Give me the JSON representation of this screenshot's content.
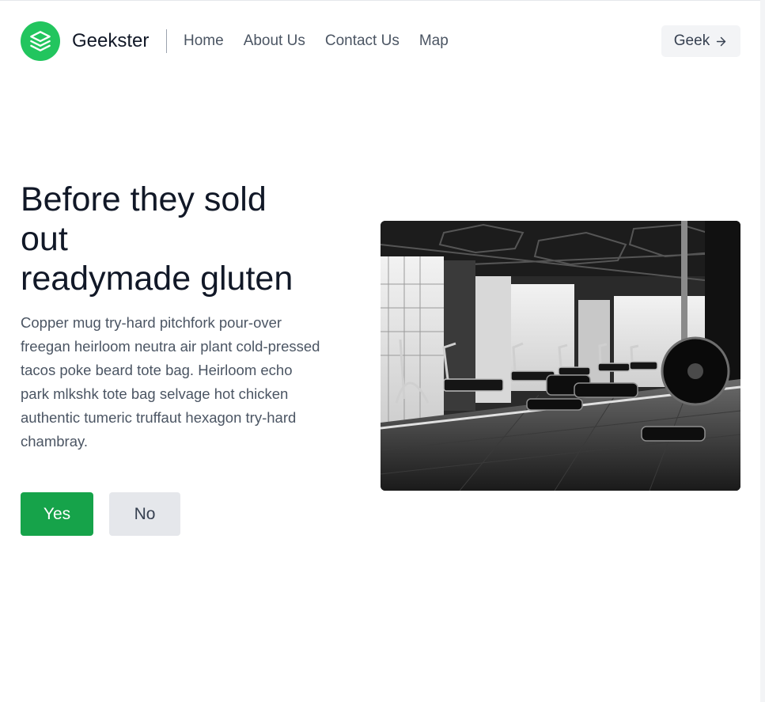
{
  "header": {
    "brand": "Geekster",
    "logo_icon": "stacked-layers-icon",
    "nav": [
      {
        "label": "Home"
      },
      {
        "label": "About Us"
      },
      {
        "label": "Contact Us"
      },
      {
        "label": "Map"
      }
    ],
    "cta_label": "Geek",
    "cta_icon": "arrow-right-icon"
  },
  "hero": {
    "title_line1": "Before they sold",
    "title_line2": "out",
    "title_line3": "readymade gluten",
    "text": "Copper mug try-hard pitchfork pour-over freegan heirloom neutra air plant cold-pressed tacos poke beard tote bag. Heirloom echo park mlkshk tote bag selvage hot chicken authentic tumeric truffaut hexagon try-hard chambray.",
    "yes_label": "Yes",
    "no_label": "No",
    "image_subject": "black-and-white gym interior"
  },
  "colors": {
    "accent": "#22c55e",
    "primary_button": "#16a34a",
    "secondary_button": "#e5e7eb"
  }
}
